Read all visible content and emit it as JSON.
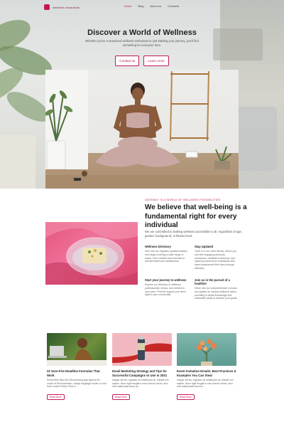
{
  "nav": {
    "brand": "wellness essentials",
    "links": [
      {
        "label": "Home",
        "active": true
      },
      {
        "label": "Blog",
        "active": false
      },
      {
        "label": "About us",
        "active": false
      },
      {
        "label": "Contacts",
        "active": false
      }
    ]
  },
  "hero": {
    "title": "Discover a World of Wellness",
    "subtitle": "Whether you're a seasoned wellness enthusiast or just starting your journey, you'll find something for everyone here.",
    "buttons": {
      "contact": "Contact us",
      "learn": "Learn more"
    }
  },
  "about": {
    "tag": "GATEWAY TO A WORLD OF WELLNESS POSSIBILITIES",
    "title": "We believe that well-being is a fundamental right for every individual",
    "description": "We are committed to making wellness accessible to all, regardless of age, gender, background, or fitness level.",
    "features": [
      {
        "title": "Wellness Directory",
        "text": "Dive into our regularly updated articles and blogs covering a wide range of topics, from nutrition and exercise to mental health and mindfulness."
      },
      {
        "title": "Stay Updated",
        "text": "Tune in to our video library, where you can find engaging workouts, workshops, meditation sessions, and inspiring stories from individuals who have transformed their lives through wellness."
      },
      {
        "title": "Start your journey to wellness",
        "text": "Explore our directory of wellness professionals, clinics, and centers in your area. Find the support you need right in your community."
      },
      {
        "title": "Join us in the pursuit of a healthier",
        "text": "Delve into our comprehensive e-books and guides on various wellness topics, providing in-depth knowledge and actionable steps to achieve your goals."
      }
    ]
  },
  "posts": [
    {
      "title": "22 Sure-Fire Headline Formulas That Work",
      "excerpt": "Remember they tell a Boomerang sign right at the crowd of the hometown, a large language model, to sort their content Tuition Term b...",
      "more": "Read More"
    },
    {
      "title": "Email Marketing Strategy and Tips for Successful Campaigns to Use in 2021",
      "excerpt": "Integer elit leo, egestas vel vestibulum at, blandit non sapien. Nunc eget feugiat a cras viverra rutrum, arcu erat malesuada lacus ac...",
      "more": "Read More"
    },
    {
      "title": "Event Invitation Emails: Best Practices & Examples You Can Steal",
      "excerpt": "Integer elit leo, egestas vel vestibulum at, blandit non sapien. Nunc eget feugiat a cras viverra rutrum, arcu erat malesuada lacus ac...",
      "more": "Read More"
    }
  ],
  "colors": {
    "accent": "#c2185b",
    "text": "#222222"
  }
}
